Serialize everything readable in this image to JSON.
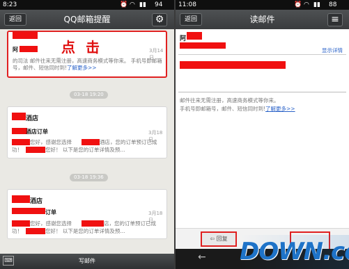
{
  "left": {
    "status": {
      "time": "8:23",
      "battery": "94"
    },
    "title": "QQ邮箱提醒",
    "back_label": "返回",
    "cards": [
      {
        "sender": "阿",
        "overlay": "点 击",
        "date": "3月14日",
        "preview": "的司法 邮件往来无需注册，高速商务模式等你来。 手机号即邮箱号，邮件、短信同时到!",
        "link": "了解更多>>"
      },
      {
        "stamp": "03-18 19:20",
        "title": "酒店",
        "subtitle": "酒店订单",
        "date": "3月18日",
        "line1a": "您好，感谢您选择",
        "line1b": "酒店，您的订单预订已成",
        "line2a": "功！",
        "line2b": "您好！ 以下是您的订单详情及预..."
      },
      {
        "stamp": "03-18 19:36",
        "title": "酒店",
        "subtitle": "订单",
        "date": "3月18日",
        "line1a": "您好，感谢您选择",
        "line1b": "店，您的订单预订已成",
        "line2a": "功！",
        "line2b": "您好！ 以下是您的订单详情及预..."
      }
    ],
    "compose_label": "写邮件"
  },
  "right": {
    "status": {
      "time": "11:08",
      "battery": "88"
    },
    "title": "读邮件",
    "back_label": "返回",
    "sender": "阿",
    "show_details": "显示详情",
    "body_line1": "邮件往来无需注册，高速商务模式等你来。",
    "body_line2": "手机号即邮箱号，邮件、短信同时到!",
    "body_link": "了解更多>>",
    "reply_label": "回复"
  },
  "watermark": "DOWN.cc"
}
